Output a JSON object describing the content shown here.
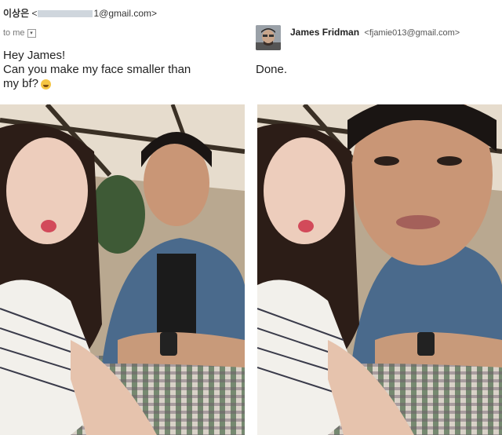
{
  "left_email": {
    "from_name": "이상은",
    "from_email_suffix": "1@gmail.com>",
    "to_label": "to me",
    "message_lines": [
      "Hey James!",
      "Can you make my face smaller than",
      "my bf?"
    ]
  },
  "right_email": {
    "sender_name": "James Fridman",
    "sender_email": "<fjamie013@gmail.com>",
    "reply_text": "Done."
  },
  "icons": {
    "dropdown": "chevron-down-icon",
    "emoji": "crying-laughing-emoji",
    "avatar": "sender-avatar"
  },
  "colors": {
    "redaction": "#cfd6dd",
    "text": "#222222"
  }
}
